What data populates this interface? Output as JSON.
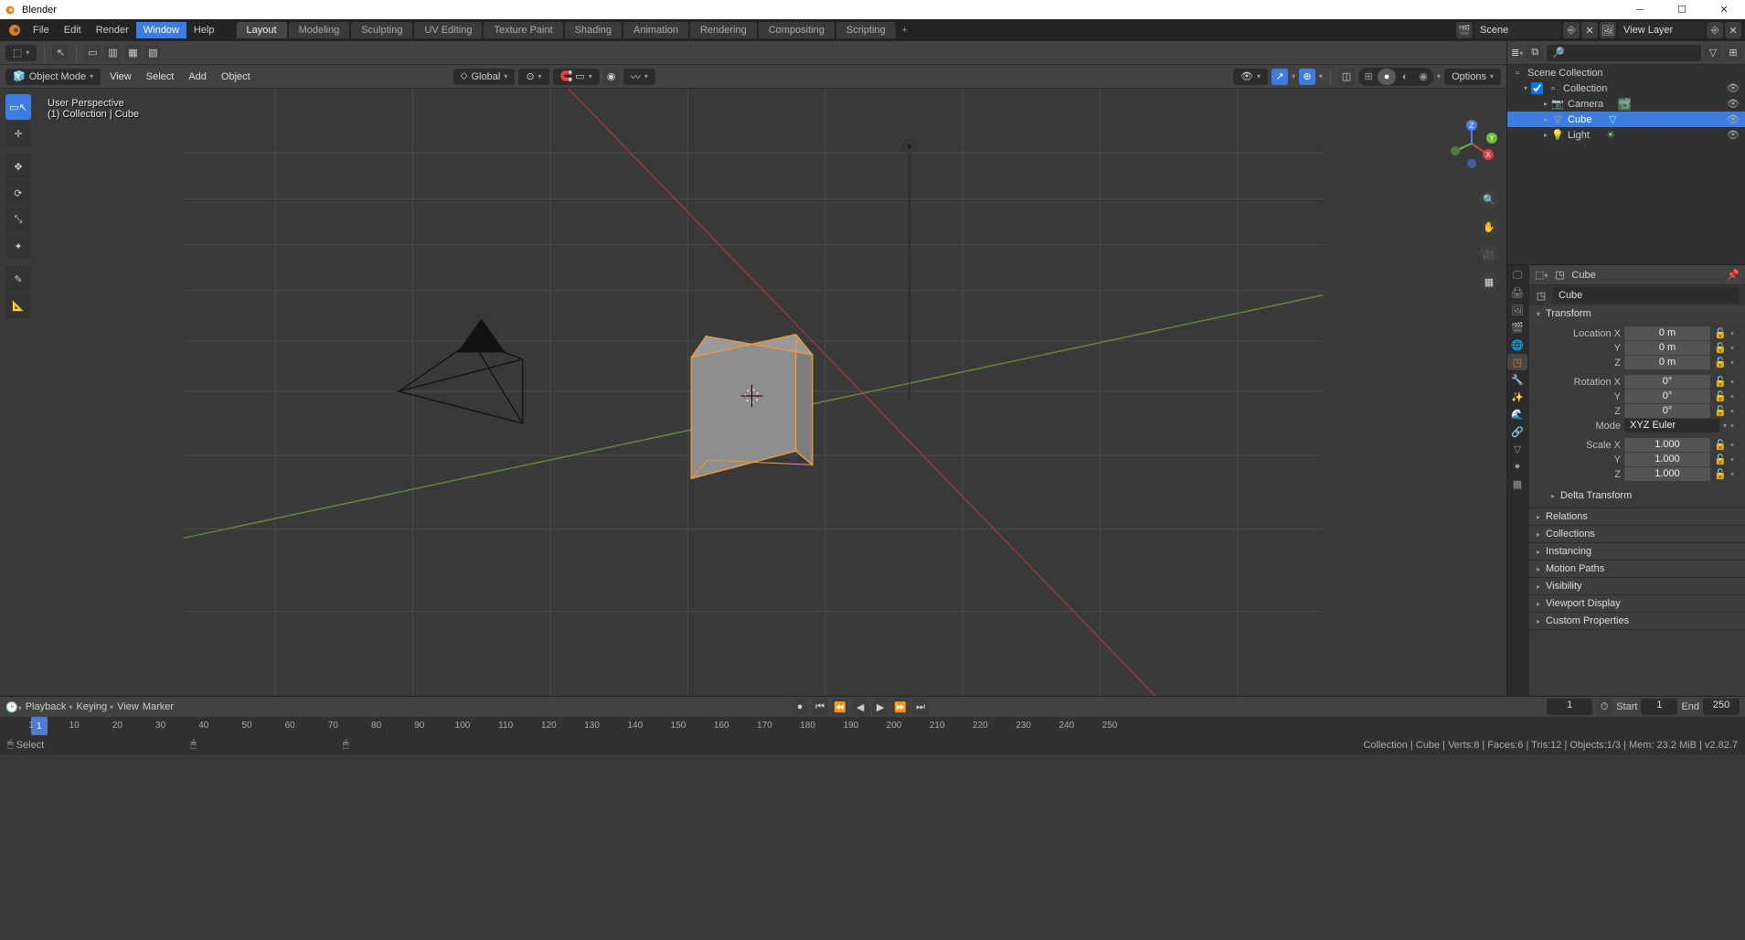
{
  "titlebar": {
    "title": "Blender"
  },
  "winmenu": {
    "file": "File",
    "edit": "Edit",
    "render": "Render",
    "window": "Window",
    "help": "Help"
  },
  "workspaces": [
    "Layout",
    "Modeling",
    "Sculpting",
    "UV Editing",
    "Texture Paint",
    "Shading",
    "Animation",
    "Rendering",
    "Compositing",
    "Scripting"
  ],
  "active_workspace": "Layout",
  "scene_field": "Scene",
  "viewlayer_field": "View Layer",
  "viewport": {
    "mode": "Object Mode",
    "menus": [
      "View",
      "Select",
      "Add",
      "Object"
    ],
    "orient": "Global",
    "options_label": "Options",
    "overlay": {
      "line1": "User Perspective",
      "line2": "(1) Collection | Cube"
    }
  },
  "outliner": {
    "root": "Scene Collection",
    "coll": "Collection",
    "items": [
      {
        "name": "Camera",
        "type": "camera"
      },
      {
        "name": "Cube",
        "type": "mesh",
        "selected": true
      },
      {
        "name": "Light",
        "type": "light"
      }
    ]
  },
  "props": {
    "crumb": "Cube",
    "obj_name": "Cube",
    "transform_title": "Transform",
    "loc_label": "Location X",
    "loc_x": "0 m",
    "loc_y": "0 m",
    "loc_z": "0 m",
    "rot_label": "Rotation X",
    "rot_x": "0°",
    "rot_y": "0°",
    "rot_z": "0°",
    "mode_label": "Mode",
    "mode_val": "XYZ Euler",
    "scl_label": "Scale X",
    "scl_x": "1.000",
    "scl_y": "1.000",
    "scl_z": "1.000",
    "panels": [
      "Delta Transform",
      "Relations",
      "Collections",
      "Instancing",
      "Motion Paths",
      "Visibility",
      "Viewport Display",
      "Custom Properties"
    ]
  },
  "timeline": {
    "menus": [
      "Playback",
      "Keying",
      "View",
      "Marker"
    ],
    "cur": "1",
    "start_label": "Start",
    "start": "1",
    "end_label": "End",
    "end": "250",
    "ticks": [
      "1",
      "10",
      "20",
      "30",
      "40",
      "50",
      "60",
      "70",
      "80",
      "90",
      "100",
      "110",
      "120",
      "130",
      "140",
      "150",
      "160",
      "170",
      "180",
      "190",
      "200",
      "210",
      "220",
      "230",
      "240",
      "250"
    ]
  },
  "statusbar": {
    "left": "Select",
    "right": "Collection | Cube | Verts:8 | Faces:6 | Tris:12 | Objects:1/3 | Mem: 23.2 MiB | v2.82.7"
  }
}
